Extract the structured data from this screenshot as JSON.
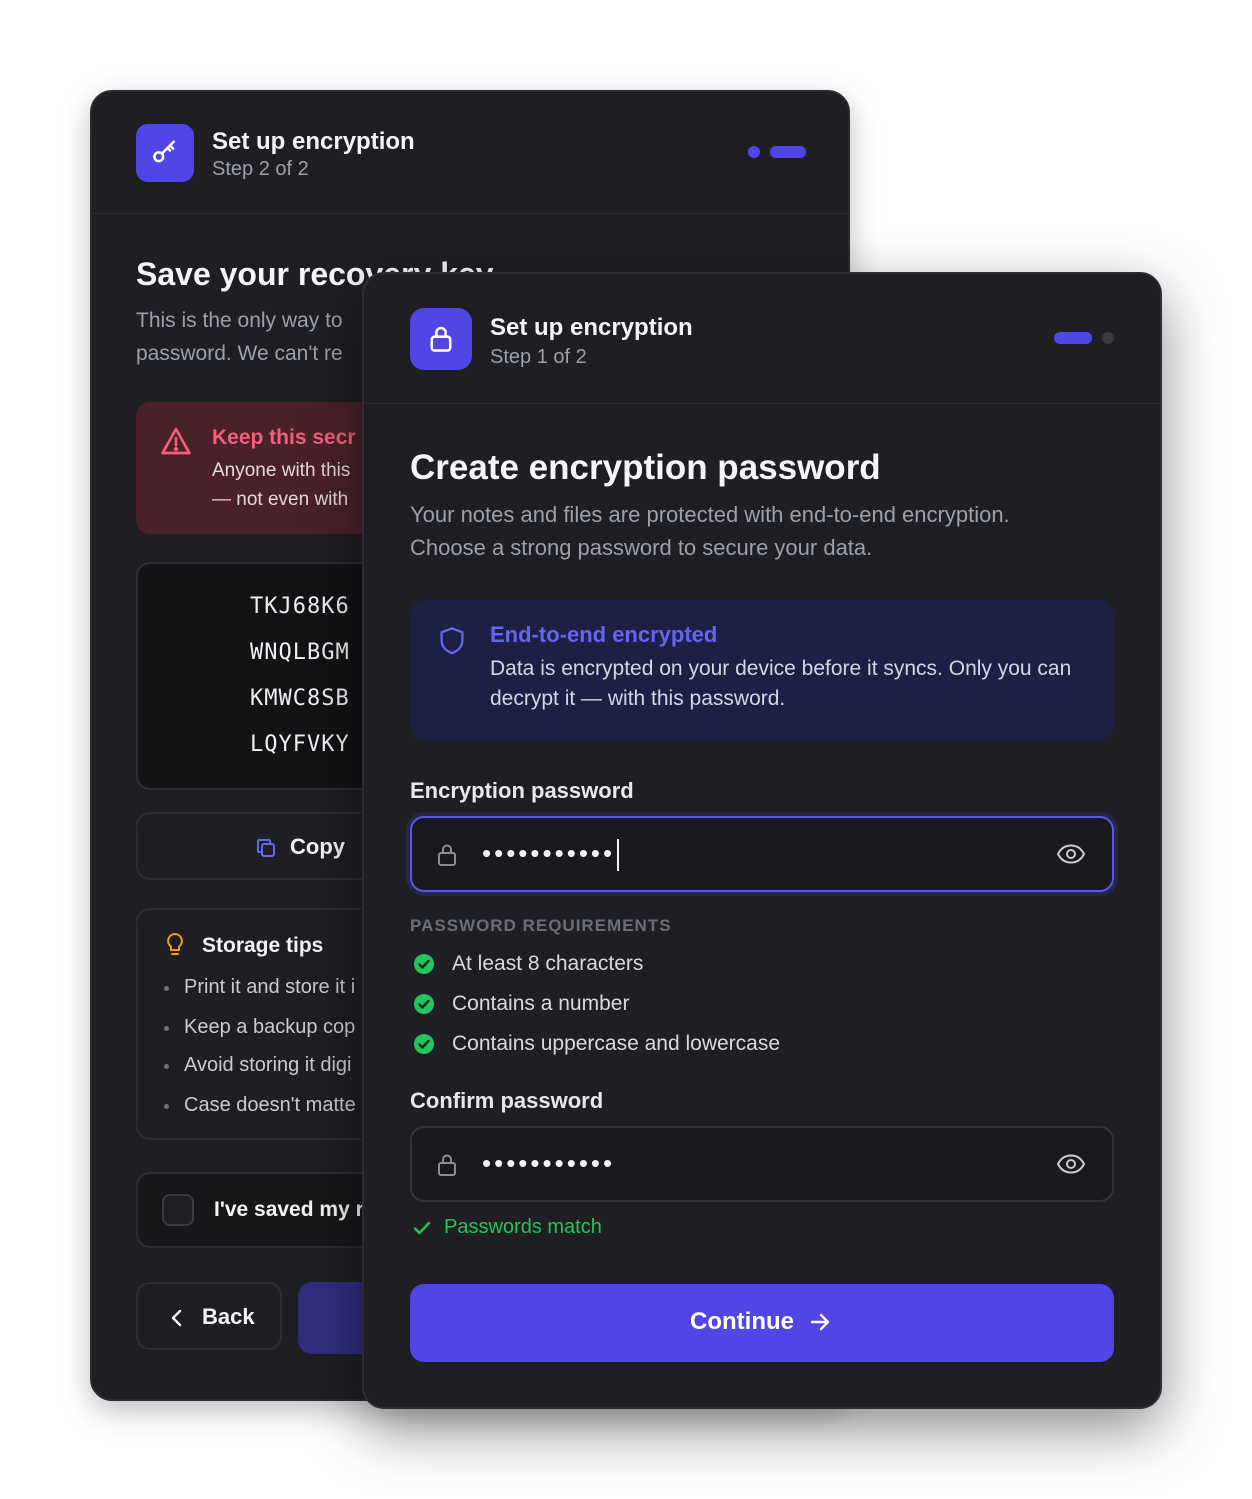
{
  "back_card": {
    "header": {
      "title": "Set up encryption",
      "step": "Step 2 of 2"
    },
    "title": "Save your recovery key",
    "description": [
      "This is the only way to",
      "password. We can't re"
    ],
    "warning": {
      "title": "Keep this secr",
      "lines": [
        "Anyone with this",
        "— not even with"
      ]
    },
    "recovery_key_lines": [
      "TKJ68K6",
      "WNQLBGM",
      "KMWC8SB",
      "LQYFVKY"
    ],
    "copy_label": "Copy",
    "tips": {
      "title": "Storage tips",
      "items": [
        "Print it and store it i",
        "Keep a backup cop",
        "Avoid storing it digi",
        "Case doesn't matte"
      ]
    },
    "saved_label": "I've saved my r",
    "back_label": "Back"
  },
  "front_card": {
    "header": {
      "title": "Set up encryption",
      "step": "Step 1 of 2"
    },
    "title": "Create encryption password",
    "description": [
      "Your notes and files are protected with end-to-end encryption.",
      "Choose a strong password to secure your data."
    ],
    "info": {
      "title": "End-to-end encrypted",
      "text": "Data is encrypted on your device before it syncs. Only you can decrypt it — with this password."
    },
    "password_label": "Encryption password",
    "password_value": "•••••••••••",
    "requirements_heading": "PASSWORD REQUIREMENTS",
    "requirements": [
      "At least 8 characters",
      "Contains a number",
      "Contains uppercase and lowercase"
    ],
    "confirm_label": "Confirm password",
    "confirm_value": "•••••••••••",
    "match_text": "Passwords match",
    "continue_label": "Continue"
  },
  "colors": {
    "accent": "#4f46e5",
    "success": "#22c55e",
    "danger": "#f2607a",
    "surface": "#1f1f23"
  },
  "icons": [
    "key-icon",
    "lock-icon",
    "warning-icon",
    "copy-icon",
    "lightbulb-icon",
    "shield-icon",
    "eye-icon",
    "check-icon",
    "chevron-left-icon",
    "arrow-right-icon"
  ]
}
